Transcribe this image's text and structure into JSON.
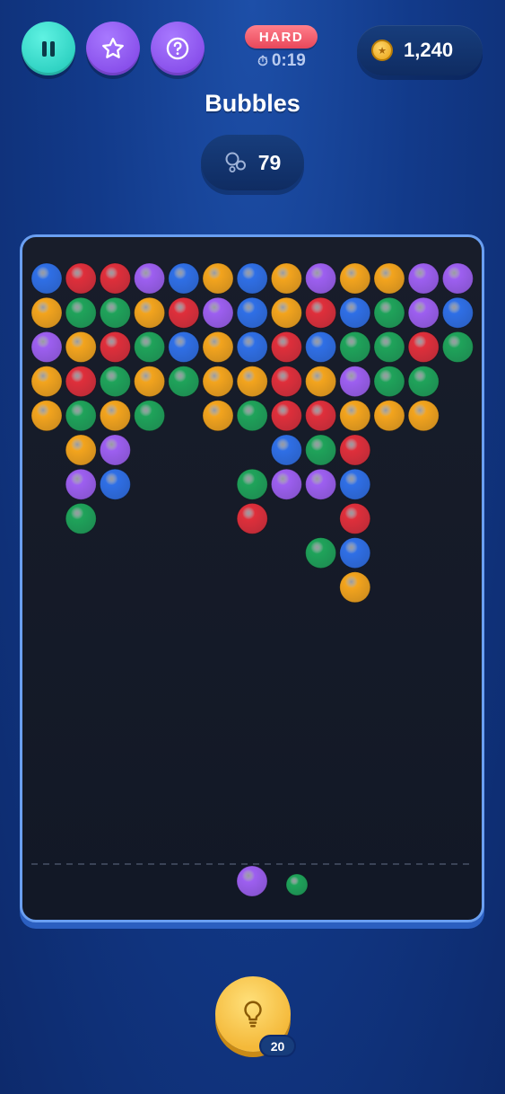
{
  "header": {
    "buttons": [
      {
        "name": "pause",
        "icon": "pause-icon"
      },
      {
        "name": "star",
        "icon": "star-icon"
      },
      {
        "name": "help",
        "icon": "question-icon"
      }
    ],
    "difficulty": "HARD",
    "timer": "0:19",
    "coins": "1,240"
  },
  "game": {
    "title": "Bubbles",
    "bubbles_remaining": "79",
    "colors": {
      "blue": "#2f6fe6",
      "red": "#df2f3b",
      "purple": "#9d5ff0",
      "orange": "#f3a41d",
      "green": "#1fa35a"
    },
    "grid": [
      [
        "blue",
        "red",
        "red",
        "purple",
        "blue",
        "orange",
        "blue",
        "orange",
        "purple",
        "orange",
        "orange",
        "purple",
        "purple"
      ],
      [
        "orange",
        "green",
        "green",
        "orange",
        "red",
        "purple",
        "blue",
        "orange",
        "red",
        "blue",
        "green",
        "purple",
        "blue"
      ],
      [
        "purple",
        "orange",
        "red",
        "green",
        "blue",
        "orange",
        "blue",
        "red",
        "blue",
        "green",
        "green",
        "red",
        "green"
      ],
      [
        "orange",
        "red",
        "green",
        "orange",
        "green",
        "orange",
        "orange",
        "red",
        "orange",
        "purple",
        "green",
        "green",
        null
      ],
      [
        "orange",
        "green",
        "orange",
        "green",
        null,
        "orange",
        "green",
        "red",
        "red",
        "orange",
        "orange",
        "orange",
        null
      ],
      [
        null,
        "orange",
        "purple",
        null,
        null,
        null,
        null,
        "blue",
        "green",
        "red",
        null,
        null,
        null
      ],
      [
        null,
        "purple",
        "blue",
        null,
        null,
        null,
        "green",
        "purple",
        "purple",
        "blue",
        null,
        null,
        null
      ],
      [
        null,
        "green",
        null,
        null,
        null,
        null,
        "red",
        null,
        null,
        "red",
        null,
        null,
        null
      ],
      [
        null,
        null,
        null,
        null,
        null,
        null,
        null,
        null,
        "green",
        "blue",
        null,
        null,
        null
      ],
      [
        null,
        null,
        null,
        null,
        null,
        null,
        null,
        null,
        null,
        "orange",
        null,
        null,
        null
      ]
    ],
    "shooter_color": "purple",
    "next_color": "green"
  },
  "hint": {
    "icon": "lightbulb-icon",
    "count": "20"
  }
}
